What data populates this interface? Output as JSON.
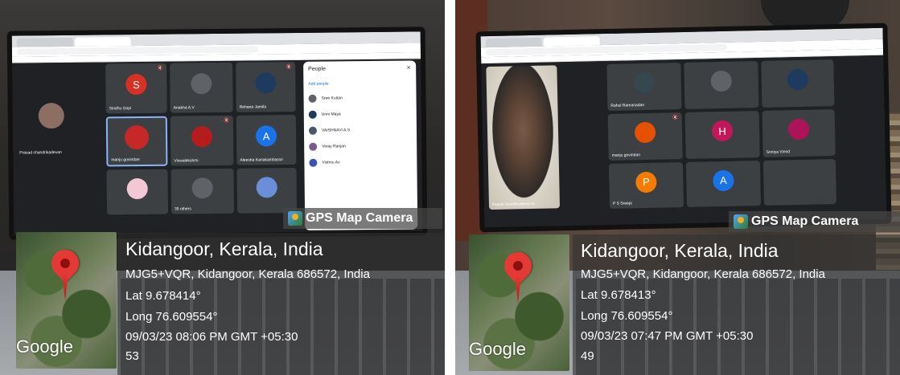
{
  "colors": {
    "pin": "#e53935",
    "overlay": "#323232",
    "meet_bg": "#202124"
  },
  "left": {
    "gps_badge": "GPS Map Camera",
    "title": "Kidangoor, Kerala, India",
    "address": "MJG5+VQR, Kidangoor, Kerala 686572, India",
    "lat": "Lat 9.678414°",
    "long": "Long 76.609554°",
    "datetime": "09/03/23 08:06 PM GMT +05:30",
    "number": "53",
    "map_brand": "Google",
    "tiles": [
      {
        "name": "Sindhu Gopi",
        "initial": "S",
        "color": "#d93025"
      },
      {
        "name": "Anakha A.V",
        "initial": "",
        "color": "#5f6368"
      },
      {
        "name": "Rehana Jamila",
        "initial": "",
        "color": "#1e3a5f"
      },
      {
        "name": "manju govindan",
        "initial": "",
        "color": "#c62828"
      },
      {
        "name": "Viswalekshmi",
        "initial": "",
        "color": "#b71c1c"
      },
      {
        "name": "Aleesha Kanakambaran",
        "initial": "A",
        "color": "#1a73e8"
      },
      {
        "name": "",
        "initial": "",
        "color": "#f3c8d4"
      },
      {
        "name": "35 others",
        "initial": "",
        "color": "#5f6368"
      },
      {
        "name": "",
        "initial": "",
        "color": "#6a8fd8"
      }
    ],
    "people": {
      "title": "People",
      "add": "Add people",
      "rows": [
        "Sree Kuttan",
        "Unni Maya",
        "VAISHNAVI A.S",
        "Vinay Ranjan",
        "Vishnu Av"
      ]
    },
    "speaker": "Prasad chandrikadevan"
  },
  "right": {
    "gps_badge": "GPS Map Camera",
    "title": "Kidangoor, Kerala, India",
    "address": "MJG5+VQR, Kidangoor, Kerala 686572, India",
    "lat": "Lat 9.678413°",
    "long": "Long 76.609554°",
    "datetime": "09/03/23 07:47 PM GMT +05:30",
    "number": "49",
    "map_brand": "Google",
    "self_name": "Prasad chandrikadevan re...",
    "tiles": [
      {
        "name": "Rahul Ramanadan",
        "initial": "",
        "color": "#37474f"
      },
      {
        "name": "",
        "initial": "",
        "color": "#5f6368"
      },
      {
        "name": "",
        "initial": "",
        "color": "#1e3a5f"
      },
      {
        "name": "manju govindan",
        "initial": "",
        "color": "#e65100"
      },
      {
        "name": "",
        "initial": "H",
        "color": "#c2185b"
      },
      {
        "name": "Soniya Vinod",
        "initial": "",
        "color": "#ad1457"
      },
      {
        "name": "P S Sreeja",
        "initial": "P",
        "color": "#f57c00"
      },
      {
        "name": "",
        "initial": "A",
        "color": "#1a73e8"
      },
      {
        "name": "",
        "initial": "",
        "color": "#3c4043"
      }
    ]
  }
}
